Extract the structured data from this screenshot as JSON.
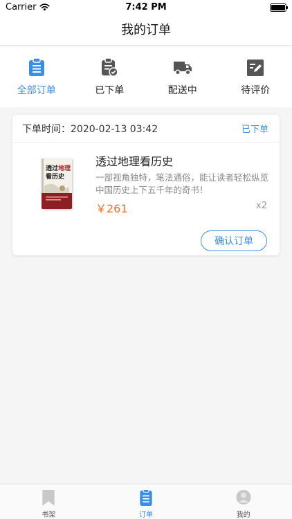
{
  "status_bar": {
    "carrier": "Carrier",
    "time": "7:42 PM"
  },
  "nav": {
    "title": "我的订单"
  },
  "tabs": [
    {
      "label": "全部订单",
      "icon": "clipboard-list-icon",
      "active": true
    },
    {
      "label": "已下单",
      "icon": "clipboard-check-icon",
      "active": false
    },
    {
      "label": "配送中",
      "icon": "truck-icon",
      "active": false
    },
    {
      "label": "待评价",
      "icon": "edit-icon",
      "active": false
    }
  ],
  "order": {
    "time_label": "下单时间：",
    "time_value": "2020-02-13 03:42",
    "status": "已下单",
    "book": {
      "title": "透过地理看历史",
      "description": "一部视角独特，笔法通俗，能让读者轻松纵览中国历史上下五千年的奇书！",
      "price": "￥261",
      "quantity": "x2"
    },
    "action_label": "确认订单"
  },
  "bottom_tabs": [
    {
      "label": "书架",
      "icon": "bookmark-icon",
      "active": false
    },
    {
      "label": "订单",
      "icon": "order-list-icon",
      "active": true
    },
    {
      "label": "我的",
      "icon": "profile-icon",
      "active": false
    }
  ],
  "colors": {
    "accent": "#3a8ee6",
    "price": "#ff6a1a",
    "inactive_icon": "#555555"
  }
}
